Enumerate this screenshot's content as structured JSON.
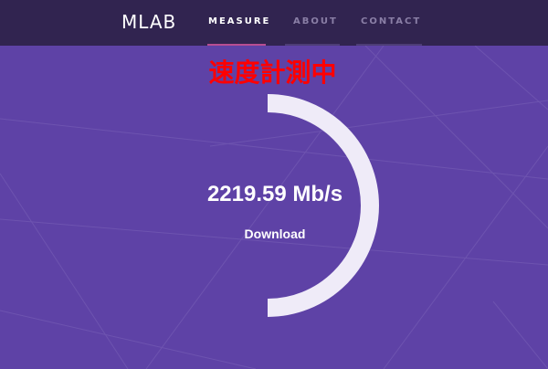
{
  "app": {
    "logo_text": "MLAB",
    "nav": [
      {
        "label": "MEASURE",
        "active": true
      },
      {
        "label": "ABOUT",
        "active": false
      },
      {
        "label": "CONTACT",
        "active": false
      }
    ]
  },
  "overlay": {
    "status_text": "速度計測中"
  },
  "test": {
    "speed_value": "2219.59 Mb/s",
    "phase_label": "Download",
    "progress_fraction": 0.5
  },
  "colors": {
    "background": "#5e42a6",
    "header": "#312450",
    "accent": "#b74e91",
    "gauge": "#efebf8",
    "overlay_text": "#ff0000"
  },
  "icons": {
    "logo": "mlab-logo-icon"
  }
}
